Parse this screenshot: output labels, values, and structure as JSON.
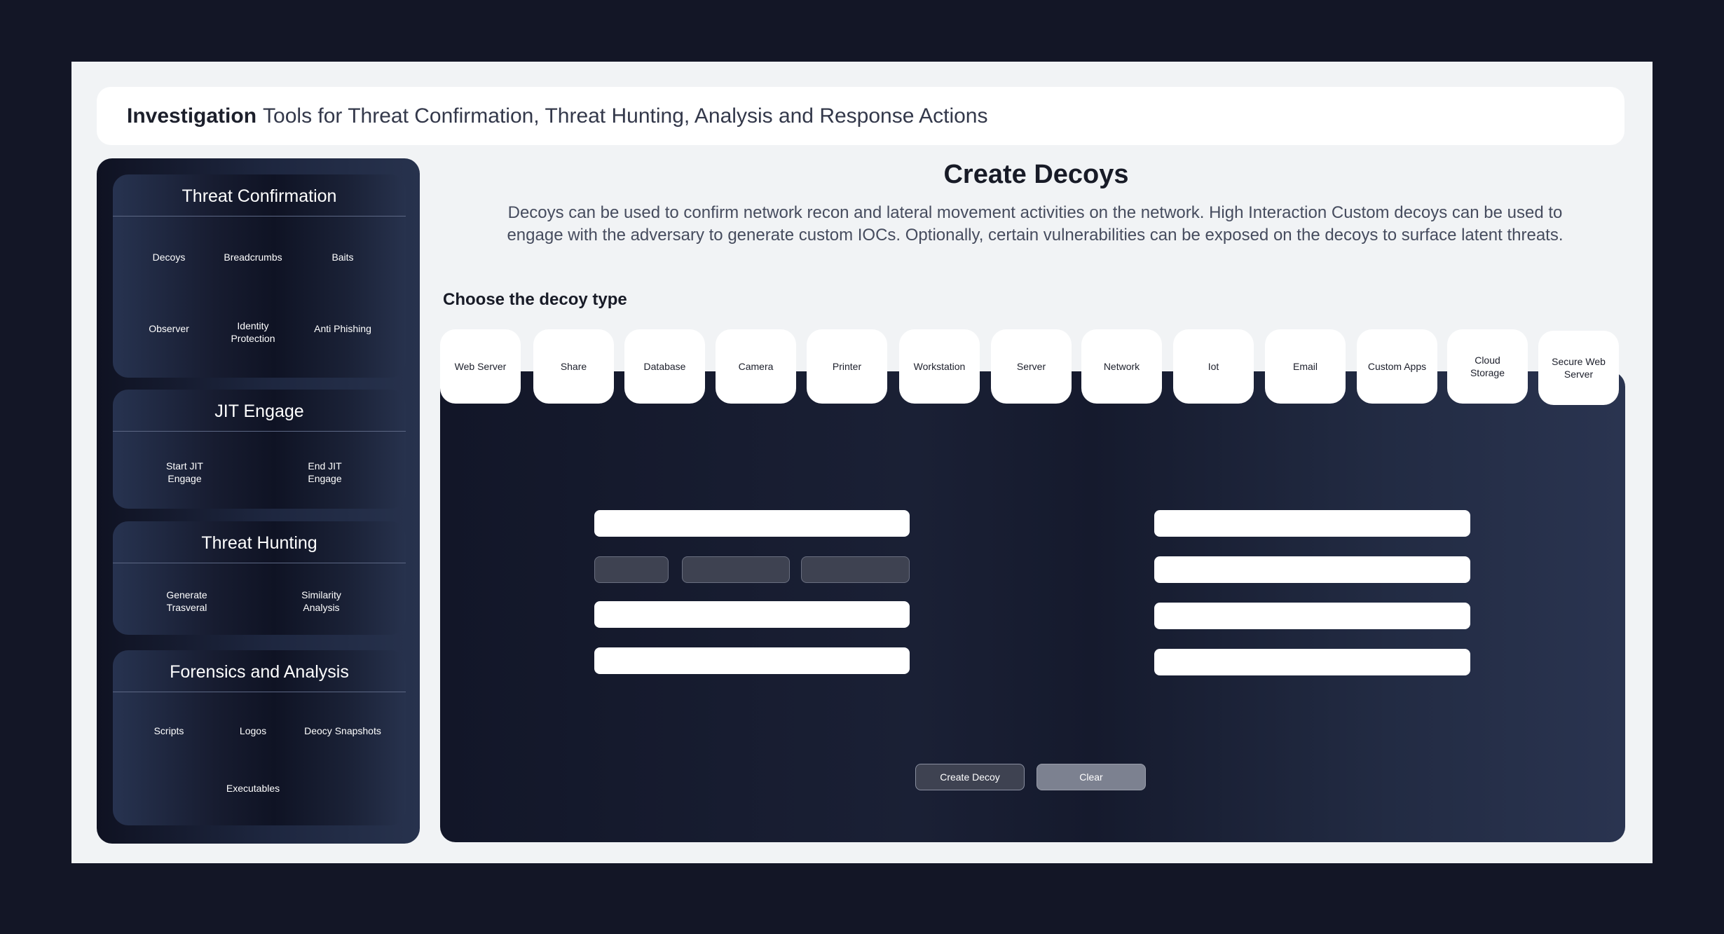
{
  "header": {
    "title": "Investigation",
    "subtitle": "Tools for Threat Confirmation, Threat Hunting, Analysis and Response Actions"
  },
  "sidebar": {
    "threat_confirmation": {
      "title": "Threat Confirmation",
      "items": [
        "Decoys",
        "Breadcrumbs",
        "Baits",
        "Observer",
        "Identity Protection",
        "Anti Phishing"
      ]
    },
    "jit_engage": {
      "title": "JIT Engage",
      "items": [
        "Start JIT Engage",
        "End JIT Engage"
      ]
    },
    "threat_hunting": {
      "title": "Threat Hunting",
      "items": [
        "Generate Trasveral",
        "Similarity Analysis"
      ]
    },
    "forensics": {
      "title": "Forensics and Analysis",
      "items": [
        "Scripts",
        "Logos",
        "Deocy Snapshots",
        "Executables"
      ]
    }
  },
  "main": {
    "title": "Create Decoys",
    "description": "Decoys can be used to confirm network recon and lateral movement activities on the network. High Interaction Custom decoys can be used to engage with the adversary to generate custom IOCs. Optionally, certain vulnerabilities can be exposed on the decoys to surface latent threats.",
    "choose_label": "Choose the decoy type",
    "decoy_types": [
      "Web Server",
      "Share",
      "Database",
      "Camera",
      "Printer",
      "Workstation",
      "Server",
      "Network",
      "Iot",
      "Email",
      "Custom Apps",
      "Cloud Storage",
      "Secure Web Server"
    ],
    "buttons": {
      "create": "Create Decoy",
      "clear": "Clear"
    }
  }
}
